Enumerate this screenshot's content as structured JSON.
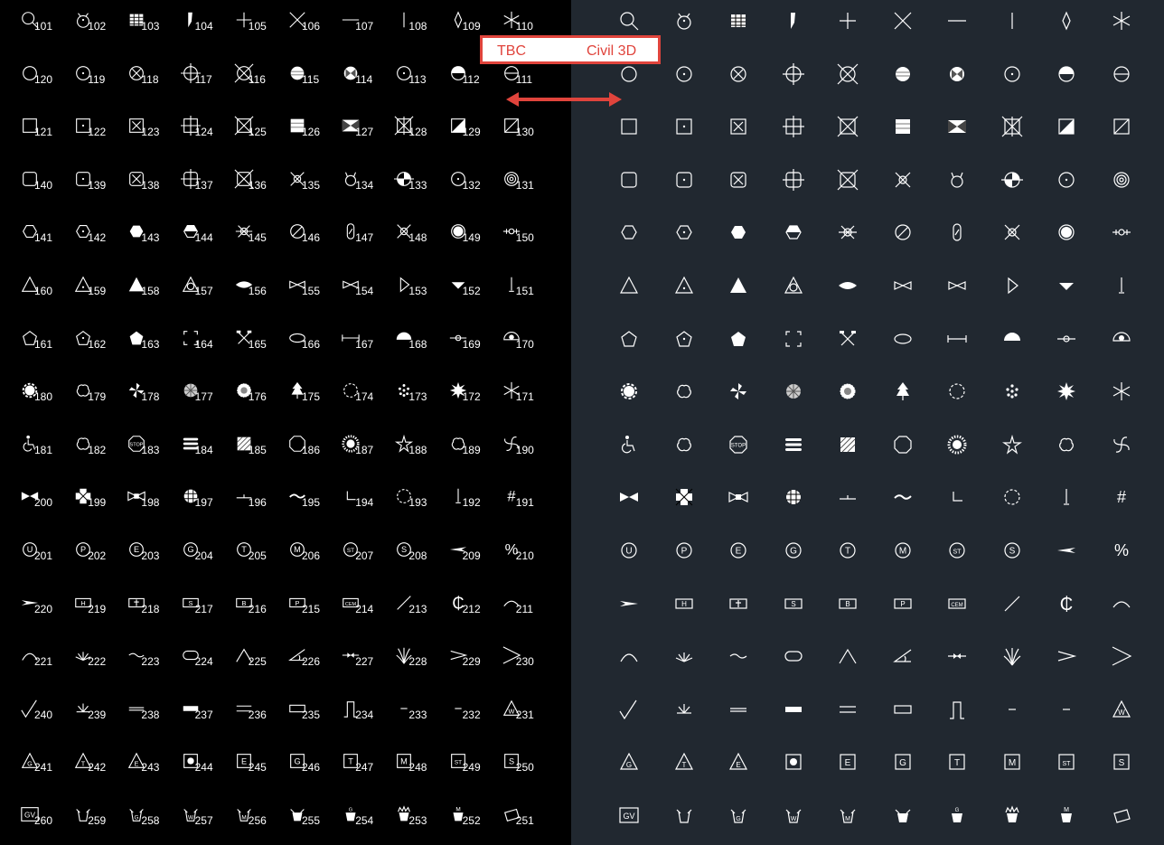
{
  "labels": {
    "left": "TBC",
    "right": "Civil 3D"
  },
  "colors": {
    "left_bg": "#000000",
    "right_bg": "#212830",
    "symbol": "#ffffff",
    "callout": "#e0443c"
  },
  "rows": [
    [
      [
        "magnify",
        "101"
      ],
      [
        "mask",
        "102"
      ],
      [
        "grid",
        "103"
      ],
      [
        "flag",
        "104"
      ],
      [
        "plus",
        "105"
      ],
      [
        "x",
        "106"
      ],
      [
        "hline",
        "107"
      ],
      [
        "vline",
        "108"
      ],
      [
        "diamond",
        "109"
      ],
      [
        "star6",
        "110"
      ]
    ],
    [
      [
        "circle",
        "120"
      ],
      [
        "circledot",
        "119"
      ],
      [
        "circlex",
        "118"
      ],
      [
        "crosscircle",
        "117"
      ],
      [
        "bigxcircle",
        "116"
      ],
      [
        "circlebars",
        "115"
      ],
      [
        "circlebow",
        "114"
      ],
      [
        "circledot",
        "113"
      ],
      [
        "halfcircle",
        "112"
      ],
      [
        "circleline",
        "111"
      ]
    ],
    [
      [
        "square",
        "121"
      ],
      [
        "squaredot",
        "122"
      ],
      [
        "squarex",
        "123"
      ],
      [
        "crosssquare",
        "124"
      ],
      [
        "bigxsquare",
        "125"
      ],
      [
        "squarebars",
        "126"
      ],
      [
        "bowtie",
        "127"
      ],
      [
        "squarexplus",
        "128"
      ],
      [
        "squarehalf",
        "129"
      ],
      [
        "squareslash",
        "130"
      ]
    ],
    [
      [
        "roundsq",
        "140"
      ],
      [
        "roundsqdot",
        "139"
      ],
      [
        "roundsqx",
        "138"
      ],
      [
        "crossroundsq",
        "137"
      ],
      [
        "bigxroundsq",
        "136"
      ],
      [
        "xsmallcircle",
        "135"
      ],
      [
        "horned",
        "134"
      ],
      [
        "quartercircle",
        "133"
      ],
      [
        "circledot",
        "132"
      ],
      [
        "target",
        "131"
      ]
    ],
    [
      [
        "hexagon",
        "141"
      ],
      [
        "hexagondot",
        "142"
      ],
      [
        "hexfill",
        "143"
      ],
      [
        "hexhalf",
        "144"
      ],
      [
        "sun",
        "145"
      ],
      [
        "slashcircle",
        "146"
      ],
      [
        "capsule",
        "147"
      ],
      [
        "xsmallcircle",
        "148"
      ],
      [
        "filledcircle",
        "149"
      ],
      [
        "valve",
        "150"
      ]
    ],
    [
      [
        "triangle",
        "160"
      ],
      [
        "triangledot",
        "159"
      ],
      [
        "trianglefill",
        "158"
      ],
      [
        "trianglecircle",
        "157"
      ],
      [
        "eyefill",
        "156"
      ],
      [
        "bowsmall",
        "155"
      ],
      [
        "bowsmall",
        "154"
      ],
      [
        "tri_right",
        "153"
      ],
      [
        "tri_down",
        "152"
      ],
      [
        "spike",
        "151"
      ]
    ],
    [
      [
        "pentagon",
        "161"
      ],
      [
        "pentagondot",
        "162"
      ],
      [
        "pentagonfill",
        "163"
      ],
      [
        "corners",
        "164"
      ],
      [
        "hammers",
        "165"
      ],
      [
        "ellipse",
        "166"
      ],
      [
        "dimline",
        "167"
      ],
      [
        "semifill",
        "168"
      ],
      [
        "lineball",
        "169"
      ],
      [
        "eyeball",
        "170"
      ]
    ],
    [
      [
        "gear",
        "180"
      ],
      [
        "cloud",
        "179"
      ],
      [
        "pinwheel",
        "178"
      ],
      [
        "shrubfill",
        "177"
      ],
      [
        "shrub",
        "176"
      ],
      [
        "tree",
        "175"
      ],
      [
        "dashcircle",
        "174"
      ],
      [
        "dotcluster",
        "173"
      ],
      [
        "starburst",
        "172"
      ],
      [
        "star6",
        "171"
      ]
    ],
    [
      [
        "wheelchair",
        "181"
      ],
      [
        "cloud",
        "182"
      ],
      [
        "stop",
        "183"
      ],
      [
        "rowsdots",
        "184"
      ],
      [
        "hatchsq",
        "185"
      ],
      [
        "octagon",
        "186"
      ],
      [
        "sunburst",
        "187"
      ],
      [
        "star5",
        "188"
      ],
      [
        "cloud",
        "189"
      ],
      [
        "swirl",
        "190"
      ]
    ],
    [
      [
        "bowtie2",
        "200"
      ],
      [
        "crossbox",
        "199"
      ],
      [
        "bowtie3",
        "198"
      ],
      [
        "gridcircle",
        "197"
      ],
      [
        "tickline",
        "196"
      ],
      [
        "wave",
        "195"
      ],
      [
        "lmark",
        "194"
      ],
      [
        "dashcircle",
        "193"
      ],
      [
        "spike",
        "192"
      ],
      [
        "hash",
        "191"
      ]
    ],
    [
      [
        "cU",
        "201"
      ],
      [
        "cP",
        "202"
      ],
      [
        "cE",
        "203"
      ],
      [
        "cG",
        "204"
      ],
      [
        "cT",
        "205"
      ],
      [
        "cM",
        "206"
      ],
      [
        "cST",
        "207"
      ],
      [
        "cS",
        "208"
      ],
      [
        "arrowhead",
        "209"
      ],
      [
        "percent",
        "210"
      ]
    ],
    [
      [
        "arrowleft",
        "220"
      ],
      [
        "bH",
        "219"
      ],
      [
        "bcross",
        "218"
      ],
      [
        "bS",
        "217"
      ],
      [
        "bB",
        "216"
      ],
      [
        "bP",
        "215"
      ],
      [
        "bCEM",
        "214"
      ],
      [
        "slash",
        "213"
      ],
      [
        "cent",
        "212"
      ],
      [
        "arc",
        "211"
      ]
    ],
    [
      [
        "arcdown",
        "221"
      ],
      [
        "grass",
        "222"
      ],
      [
        "tilde",
        "223"
      ],
      [
        "pill",
        "224"
      ],
      [
        "caret",
        "225"
      ],
      [
        "angle",
        "226"
      ],
      [
        "arrowdouble",
        "227"
      ],
      [
        "reeds",
        "228"
      ],
      [
        "chevron",
        "229"
      ],
      [
        "bigchevron",
        "230"
      ]
    ],
    [
      [
        "check",
        "240"
      ],
      [
        "grass2",
        "239"
      ],
      [
        "doubleline",
        "238"
      ],
      [
        "barfill",
        "237"
      ],
      [
        "equals",
        "236"
      ],
      [
        "rect",
        "235"
      ],
      [
        "pillar",
        "234"
      ],
      [
        "dash",
        "233"
      ],
      [
        "dash",
        "232"
      ],
      [
        "triangleW",
        "231"
      ]
    ],
    [
      [
        "tG",
        "241"
      ],
      [
        "tT",
        "242"
      ],
      [
        "tE",
        "243"
      ],
      [
        "sfill",
        "244"
      ],
      [
        "sE",
        "245"
      ],
      [
        "sG",
        "246"
      ],
      [
        "sT",
        "247"
      ],
      [
        "sM",
        "248"
      ],
      [
        "sST",
        "249"
      ],
      [
        "sS",
        "250"
      ]
    ],
    [
      [
        "bGV",
        "260"
      ],
      [
        "cup",
        "259"
      ],
      [
        "cupG",
        "258"
      ],
      [
        "cupW",
        "257"
      ],
      [
        "cupM",
        "256"
      ],
      [
        "cupfill",
        "255"
      ],
      [
        "cupgfill",
        "254"
      ],
      [
        "crown",
        "253"
      ],
      [
        "crownM",
        "252"
      ],
      [
        "tag",
        "251"
      ]
    ]
  ]
}
